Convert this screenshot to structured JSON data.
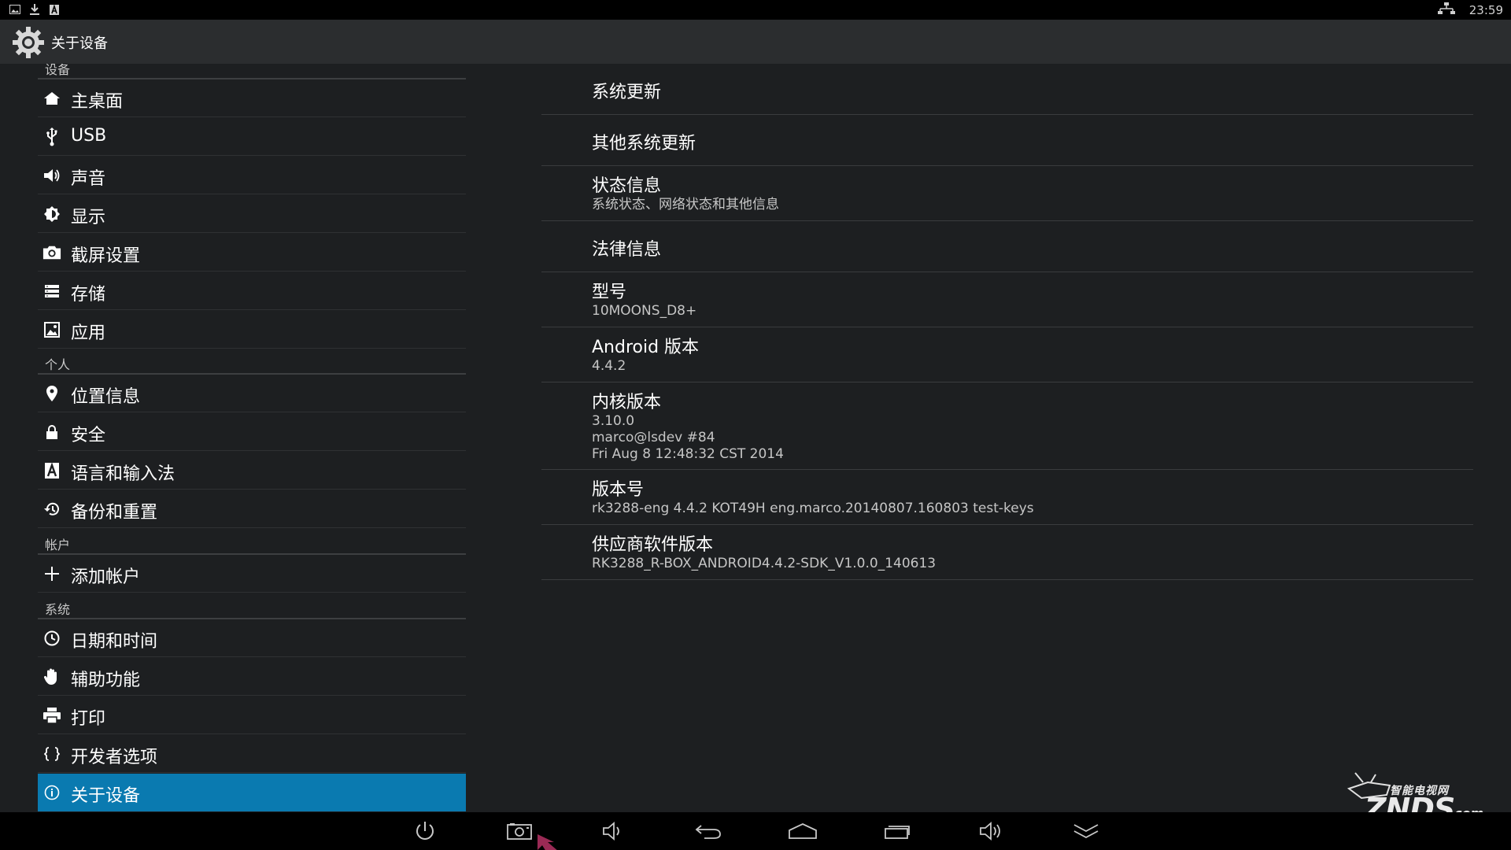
{
  "status_bar": {
    "icons": [
      "image-icon",
      "download-icon",
      "keyboard-icon"
    ],
    "network_icon": "ethernet-icon",
    "time": "23:59"
  },
  "action_bar": {
    "icon": "settings-gear-icon",
    "title": "关于设备"
  },
  "sidebar": {
    "sections": {
      "device": "设备",
      "personal": "个人",
      "accounts": "帐户",
      "system": "系统"
    },
    "items": [
      {
        "label": "主桌面",
        "icon": "home-icon"
      },
      {
        "label": "USB",
        "icon": "usb-icon"
      },
      {
        "label": "声音",
        "icon": "volume-icon"
      },
      {
        "label": "显示",
        "icon": "brightness-icon"
      },
      {
        "label": "截屏设置",
        "icon": "camera-icon"
      },
      {
        "label": "存储",
        "icon": "storage-icon"
      },
      {
        "label": "应用",
        "icon": "apps-icon"
      },
      {
        "label": "位置信息",
        "icon": "location-pin-icon"
      },
      {
        "label": "安全",
        "icon": "lock-icon"
      },
      {
        "label": "语言和输入法",
        "icon": "keyboard-a-icon"
      },
      {
        "label": "备份和重置",
        "icon": "backup-restore-icon"
      },
      {
        "label": "添加帐户",
        "icon": "plus-icon"
      },
      {
        "label": "日期和时间",
        "icon": "clock-icon"
      },
      {
        "label": "辅助功能",
        "icon": "hand-icon"
      },
      {
        "label": "打印",
        "icon": "printer-icon"
      },
      {
        "label": "开发者选项",
        "icon": "braces-icon"
      },
      {
        "label": "关于设备",
        "icon": "info-icon",
        "selected": true
      }
    ]
  },
  "about": {
    "items": [
      {
        "title": "系统更新"
      },
      {
        "title": "其他系统更新"
      },
      {
        "title": "状态信息",
        "summary": "系统状态、网络状态和其他信息"
      },
      {
        "title": "法律信息"
      },
      {
        "title": "型号",
        "summary": "10MOONS_D8+"
      },
      {
        "title": "Android 版本",
        "summary": "4.4.2"
      },
      {
        "title": "内核版本",
        "summary": "3.10.0\nmarco@lsdev #84\nFri Aug 8 12:48:32 CST 2014"
      },
      {
        "title": "版本号",
        "summary": "rk3288-eng 4.4.2 KOT49H eng.marco.20140807.160803 test-keys"
      },
      {
        "title": "供应商软件版本",
        "summary": "RK3288_R-BOX_ANDROID4.4.2-SDK_V1.0.0_140613"
      }
    ]
  },
  "nav_bar": {
    "buttons": [
      "power-icon",
      "screenshot-icon",
      "volume-down-icon",
      "back-icon",
      "home-icon",
      "recent-apps-icon",
      "volume-up-icon",
      "hide-bar-icon"
    ]
  },
  "watermark": {
    "top": "智能电视网",
    "main": "ZNDS",
    "suffix": ".com"
  },
  "colors": {
    "background": "#1d1f21",
    "action_bar": "#2b2d2f",
    "selected": "#0a7ab0",
    "divider": "#3a3c3e"
  }
}
